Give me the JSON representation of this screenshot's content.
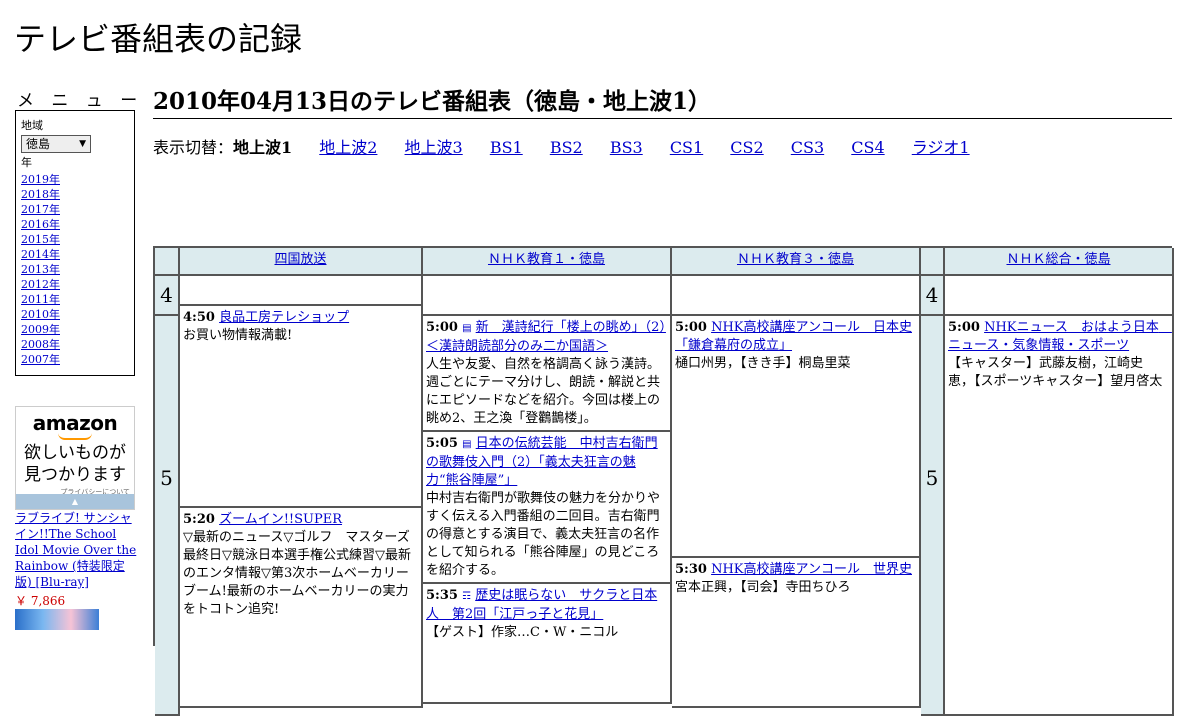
{
  "site_title": "テレビ番組表の記録",
  "menu": {
    "heading": "メ ニ ュ ー",
    "region_label": "地域",
    "region_value": "徳島",
    "year_label": "年",
    "years": [
      "2019年",
      "2018年",
      "2017年",
      "2016年",
      "2015年",
      "2014年",
      "2013年",
      "2012年",
      "2011年",
      "2010年",
      "2009年",
      "2008年",
      "2007年"
    ]
  },
  "ad": {
    "logo": "amazon",
    "copy_line1": "欲しいものが",
    "copy_line2": "見つかります",
    "privacy": "プライバシーについて",
    "product_title": "ラブライブ! サンシャイン!!The School Idol Movie Over the Rainbow (特装限定版) [Blu-ray]",
    "product_price": "￥ 7,866"
  },
  "heading": "2010年04月13日のテレビ番組表（徳島・地上波1）",
  "switcher": {
    "label": "表示切替：",
    "current": "地上波1",
    "links": [
      "地上波2",
      "地上波3",
      "BS1",
      "BS2",
      "BS3",
      "CS1",
      "CS2",
      "CS3",
      "CS4",
      "ラジオ1"
    ]
  },
  "channels": [
    "四国放送",
    "ＮＨＫ教育１・徳島",
    "ＮＨＫ教育３・徳島",
    "ＮＨＫ総合・徳島"
  ],
  "hours": [
    "4",
    "5",
    "4",
    "5"
  ],
  "programs": {
    "ch1": [
      {
        "time": "4:50",
        "title": "良品工房テレショップ",
        "desc": "お買い物情報満載!"
      },
      {
        "time": "5:20",
        "title": "ズームイン!!SUPER",
        "desc": "▽最新のニュース▽ゴルフ　マスターズ最終日▽競泳日本選手権公式練習▽最新のエンタ情報▽第3次ホームベーカリーブーム!最新のホームベーカリーの実力をトコトン追究!"
      }
    ],
    "ch2": [
      {
        "time": "5:00",
        "icon": "▤",
        "title": "新　漢詩紀行「楼上の眺め」（2）＜漢詩朗読部分のみ二か国語＞",
        "desc": "人生や友愛、自然を格調高く詠う漢詩。週ごとにテーマ分けし、朗読・解説と共にエピソードなどを紹介。今回は楼上の眺め2、王之渙「登鸛鵲楼」。"
      },
      {
        "time": "5:05",
        "icon": "▤",
        "title": "日本の伝統芸能　中村吉右衛門の歌舞伎入門（2）「義太夫狂言の魅力“熊谷陣屋”」",
        "desc": "中村吉右衛門が歌舞伎の魅力を分かりやすく伝える入門番組の二回目。吉右衛門の得意とする演目で、義太夫狂言の名作として知られる「熊谷陣屋」の見どころを紹介する。"
      },
      {
        "time": "5:35",
        "icon": "☶",
        "title": "歴史は眠らない　サクラと日本人　第2回「江戸っ子と花見」",
        "desc": "【ゲスト】作家…C・W・ニコル"
      }
    ],
    "ch3": [
      {
        "time": "5:00",
        "title": "NHK高校講座アンコール　日本史「鎌倉幕府の成立」",
        "desc": "樋口州男，【きき手】桐島里菜"
      },
      {
        "time": "5:30",
        "title": "NHK高校講座アンコール　世界史",
        "desc": "宮本正興，【司会】寺田ちひろ"
      }
    ],
    "ch4": [
      {
        "time": "5:00",
        "title": "NHKニュース　おはよう日本　ニュース・気象情報・スポーツ",
        "desc": "【キャスター】武藤友樹，江崎史恵，【スポーツキャスター】望月啓太"
      }
    ]
  }
}
